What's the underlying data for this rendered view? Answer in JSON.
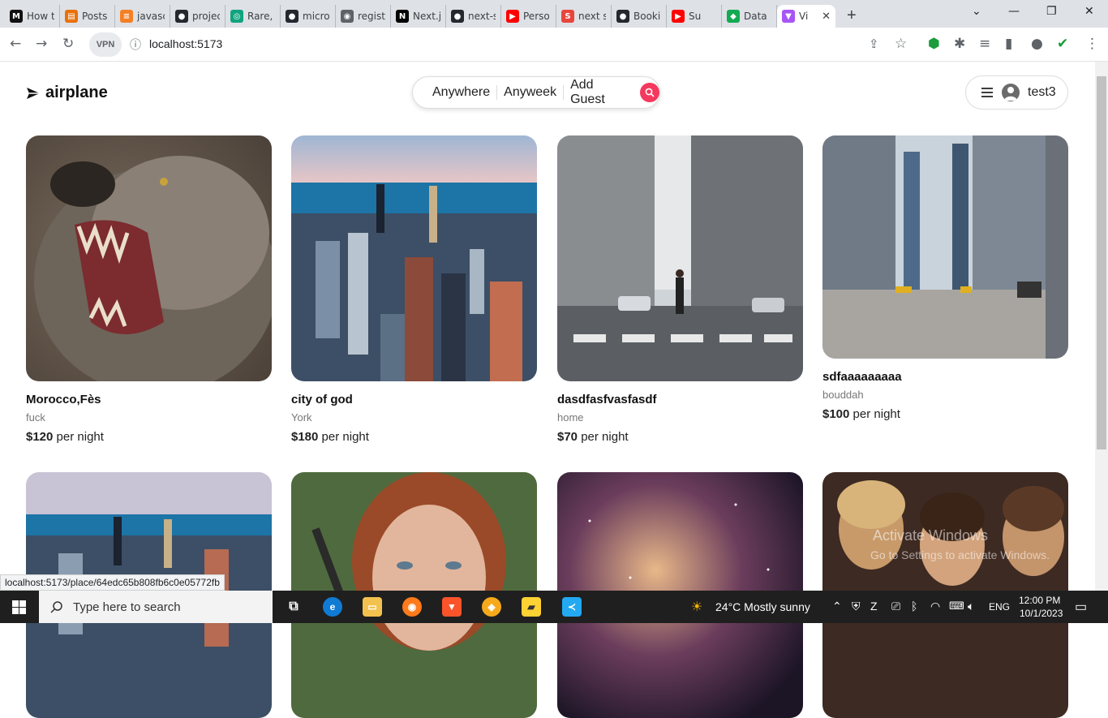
{
  "browser": {
    "tabs": [
      {
        "label": "How t",
        "fav": "M",
        "color": "#111111"
      },
      {
        "label": "Posts",
        "fav": "▤",
        "color": "#e8710a"
      },
      {
        "label": "javasc",
        "fav": "≡",
        "color": "#f48024"
      },
      {
        "label": "projec",
        "fav": "●",
        "color": "#24292f"
      },
      {
        "label": "Rare,",
        "fav": "◎",
        "color": "#10a37f"
      },
      {
        "label": "micro",
        "fav": "●",
        "color": "#24292f"
      },
      {
        "label": "regist",
        "fav": "◉",
        "color": "#5f6368"
      },
      {
        "label": "Next.j",
        "fav": "N",
        "color": "#000000"
      },
      {
        "label": "next-s",
        "fav": "●",
        "color": "#24292f"
      },
      {
        "label": "Perso",
        "fav": "▶",
        "color": "#ff0000"
      },
      {
        "label": "next s",
        "fav": "S",
        "color": "#e8453c"
      },
      {
        "label": "Booki",
        "fav": "●",
        "color": "#24292f"
      },
      {
        "label": "Su",
        "fav": "▶",
        "color": "#ff0000"
      },
      {
        "label": "Data",
        "fav": "◆",
        "color": "#13aa52"
      },
      {
        "label": "Vi",
        "fav": "▼",
        "color": "#a855f7"
      }
    ],
    "url": "localhost:5173",
    "vpn_label": "VPN",
    "status_url": "localhost:5173/place/64edc65b808fb6c0e05772fb"
  },
  "site": {
    "brand": "airplane",
    "search": {
      "where": "Anywhere",
      "when": "Anyweek",
      "guests": "Add Guest"
    },
    "user": {
      "name": "test3"
    },
    "accent": "#f5385d"
  },
  "listings": [
    {
      "title": "Morocco,Fès",
      "location": "fuck",
      "price": "$120",
      "unit": "per night",
      "image": "wolf"
    },
    {
      "title": "city of god",
      "location": "York",
      "price": "$180",
      "unit": "per night",
      "image": "city-skyline"
    },
    {
      "title": "dasdfasfvasfasdf",
      "location": "home",
      "price": "$70",
      "unit": "per night",
      "image": "street-crosswalk"
    },
    {
      "title": "sdfaaaaaaaaa",
      "location": "bouddah",
      "price": "$100",
      "unit": "per night",
      "image": "city-street"
    },
    {
      "title": "",
      "location": "",
      "price": "",
      "unit": "",
      "image": "city-skyline"
    },
    {
      "title": "",
      "location": "",
      "price": "",
      "unit": "",
      "image": "portrait"
    },
    {
      "title": "",
      "location": "",
      "price": "",
      "unit": "",
      "image": "galaxy"
    },
    {
      "title": "",
      "location": "",
      "price": "",
      "unit": "",
      "image": "painting"
    }
  ],
  "watermark": {
    "line1": "Activate Windows",
    "line2": "Go to Settings to activate Windows."
  },
  "taskbar": {
    "search_placeholder": "Type here to search",
    "weather": "24°C  Mostly sunny",
    "lang": "ENG",
    "time": "12:00 PM",
    "date": "10/1/2023"
  }
}
